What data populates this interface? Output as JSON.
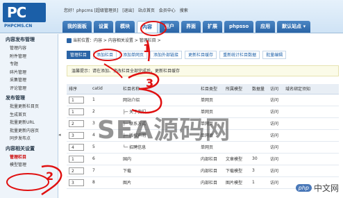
{
  "logo": {
    "main": "PC",
    "sub": "PHPCMS.CN"
  },
  "userinfo": [
    "您好！phpcms [超级管理员]",
    "[退出]",
    "站点首页",
    "会员中心",
    "搜索"
  ],
  "nav": [
    "我的面板",
    "设置",
    "模块",
    "内容",
    "用户",
    "界面",
    "扩展",
    "phpsso",
    "应用",
    "默认站点 ▾"
  ],
  "nav_active": "内容",
  "sidebar": {
    "group1": "内容发布管理",
    "group1_items": [
      "管理内容",
      "附件管理",
      "专题",
      "碎片管理",
      "采集管理",
      "评论管理"
    ],
    "group2": "发布管理",
    "group2_items": [
      "批量更新栏目页",
      "生成首页",
      "批量更新URL",
      "批量更新内容页",
      "同步发布点"
    ],
    "group3": "内容相关设置",
    "group3_items": [
      "管理栏目",
      "模型管理"
    ]
  },
  "breadcrumb": "当前位置：内容 > 内容相关设置 > 管理栏目 >",
  "subtabs": [
    "管理栏目",
    "添加栏目",
    "添加单网页",
    "添加外部链接",
    "更新栏目缓存",
    "重新统计栏目数据",
    "批量编辑"
  ],
  "tip": "温馨提示：请在添加、修改栏目全部完成后，更新栏目缓存",
  "table": {
    "headers": [
      "排序",
      "catid",
      "栏目名称",
      "栏目类型",
      "所属模型",
      "数据量",
      "访问",
      "域名绑定须知"
    ],
    "rows": [
      {
        "order": "1",
        "catid": "1",
        "name": "网站介绍",
        "type": "单网页",
        "model": "",
        "count": "",
        "visit": "访问"
      },
      {
        "order": "1",
        "catid": "2",
        "name": "├─ 关于我们",
        "type": "单网页",
        "model": "",
        "count": "",
        "visit": "访问"
      },
      {
        "order": "2",
        "catid": "3",
        "name": "├─ 联系方式",
        "type": "单网页",
        "model": "",
        "count": "",
        "visit": "访问"
      },
      {
        "order": "3",
        "catid": "4",
        "name": "├─ 版权声明",
        "type": "单网页",
        "model": "",
        "count": "",
        "visit": "访问"
      },
      {
        "order": "4",
        "catid": "5",
        "name": "└─ 招聘信息",
        "type": "单网页",
        "model": "",
        "count": "",
        "visit": "访问"
      },
      {
        "order": "1",
        "catid": "6",
        "name": "国内",
        "type": "内部栏目",
        "model": "文章模型",
        "count": "30",
        "visit": "访问"
      },
      {
        "order": "2",
        "catid": "7",
        "name": "下载",
        "type": "内部栏目",
        "model": "下载模型",
        "count": "3",
        "visit": "访问"
      },
      {
        "order": "3",
        "catid": "8",
        "name": "图片",
        "type": "内部栏目",
        "model": "图片模型",
        "count": "1",
        "visit": "访问"
      }
    ]
  },
  "annotations": [
    "1",
    "2",
    "3"
  ],
  "watermark": "SEA源码网",
  "corner_logo": {
    "badge": "php",
    "text": "中文网"
  }
}
